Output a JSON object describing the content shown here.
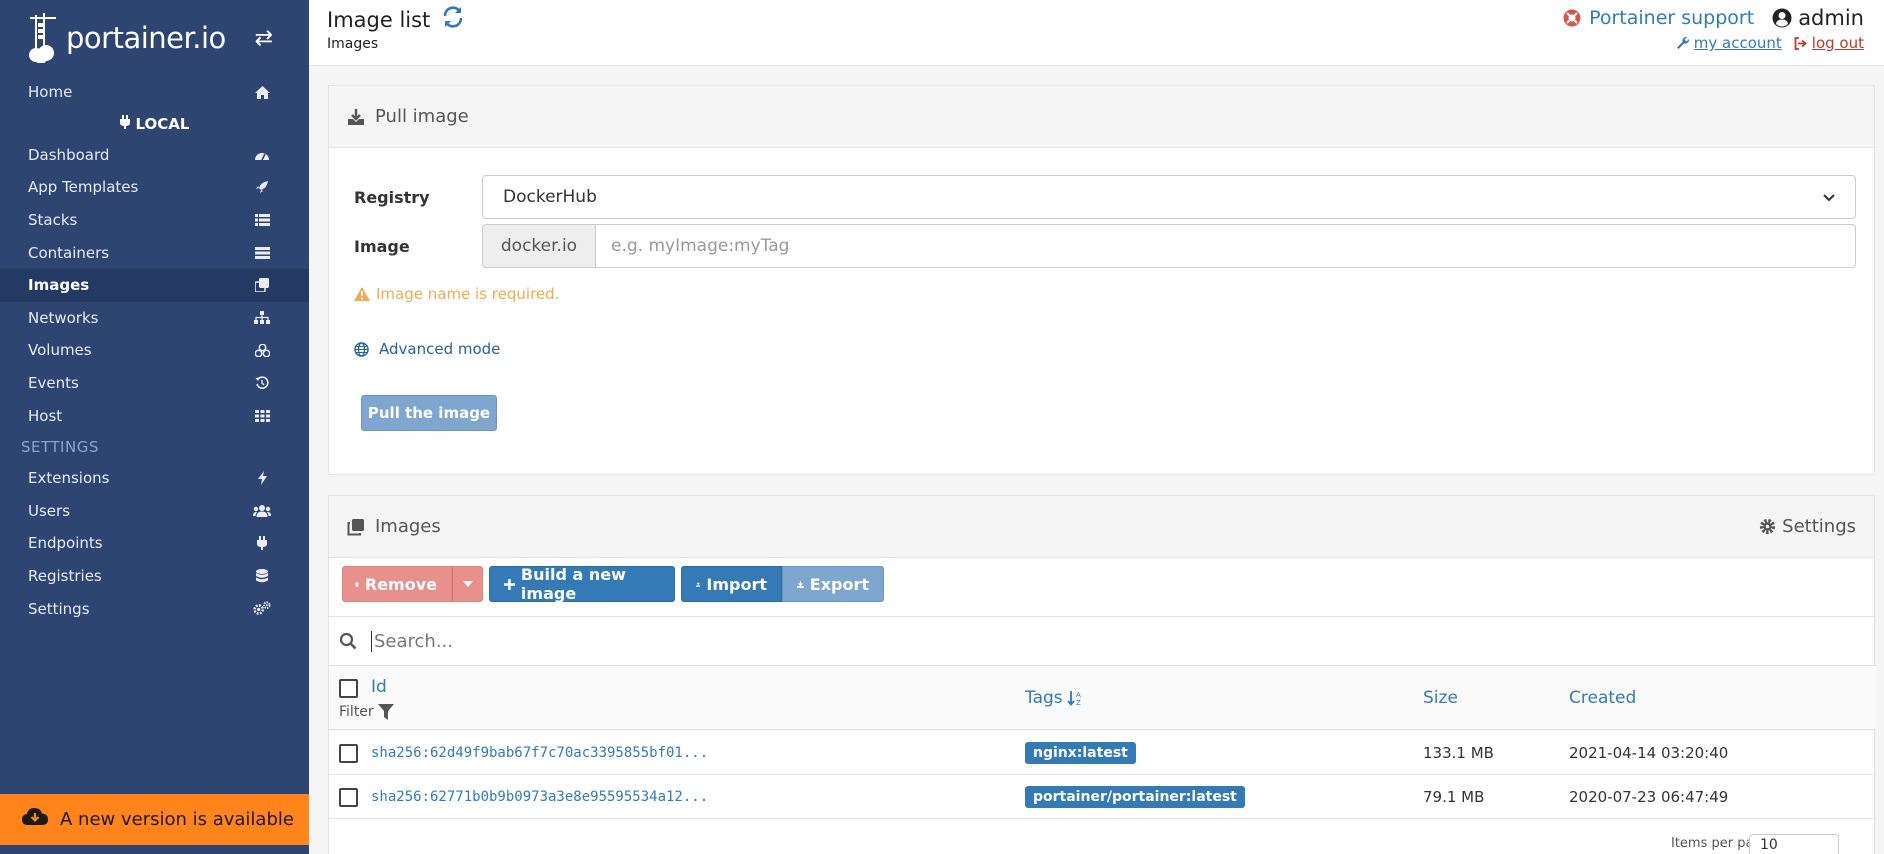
{
  "sidebar": {
    "logo": "portainer.io",
    "local_label": "LOCAL",
    "settings_section": "SETTINGS",
    "items": [
      {
        "label": "Home",
        "icon": "home-icon"
      },
      {
        "label": "Dashboard",
        "icon": "dashboard-icon"
      },
      {
        "label": "App Templates",
        "icon": "rocket-icon"
      },
      {
        "label": "Stacks",
        "icon": "list-icon"
      },
      {
        "label": "Containers",
        "icon": "server-icon"
      },
      {
        "label": "Images",
        "icon": "clone-icon"
      },
      {
        "label": "Networks",
        "icon": "sitemap-icon"
      },
      {
        "label": "Volumes",
        "icon": "cubes-icon"
      },
      {
        "label": "Events",
        "icon": "history-icon"
      },
      {
        "label": "Host",
        "icon": "grid-icon"
      },
      {
        "label": "Extensions",
        "icon": "bolt-icon"
      },
      {
        "label": "Users",
        "icon": "users-icon"
      },
      {
        "label": "Endpoints",
        "icon": "plug-icon"
      },
      {
        "label": "Registries",
        "icon": "database-icon"
      },
      {
        "label": "Settings",
        "icon": "cogs-icon"
      }
    ],
    "update_banner": "A new version is available"
  },
  "header": {
    "title": "Image list",
    "subtitle": "Images",
    "support": "Portainer support",
    "user": "admin",
    "my_account": "my account",
    "log_out": "log out"
  },
  "pull_panel": {
    "title": "Pull image",
    "registry_label": "Registry",
    "registry_value": "DockerHub",
    "image_label": "Image",
    "image_prefix": "docker.io",
    "image_placeholder": "e.g. myImage:myTag",
    "warning": "Image name is required.",
    "advanced": "Advanced mode",
    "pull_button": "Pull the image"
  },
  "images_panel": {
    "title": "Images",
    "settings": "Settings",
    "toolbar": {
      "remove": "Remove",
      "build": "Build a new image",
      "import": "Import",
      "export": "Export"
    },
    "search_placeholder": "Search...",
    "columns": {
      "id": "Id",
      "filter": "Filter",
      "tags": "Tags",
      "size": "Size",
      "created": "Created"
    },
    "rows": [
      {
        "id": "sha256:62d49f9bab67f7c70ac3395855bf01...",
        "tag": "nginx:latest",
        "size": "133.1 MB",
        "created": "2021-04-14 03:20:40"
      },
      {
        "id": "sha256:62771b0b9b0973a3e8e95595534a12...",
        "tag": "portainer/portainer:latest",
        "size": "79.1 MB",
        "created": "2020-07-23 06:47:49"
      }
    ],
    "items_per_page_label": "Items per page",
    "items_per_page_value": "10"
  },
  "colors": {
    "sidebar": "#2e4572",
    "primary": "#337ab7",
    "warning": "#f0ad4e",
    "banner": "#ff851b"
  }
}
